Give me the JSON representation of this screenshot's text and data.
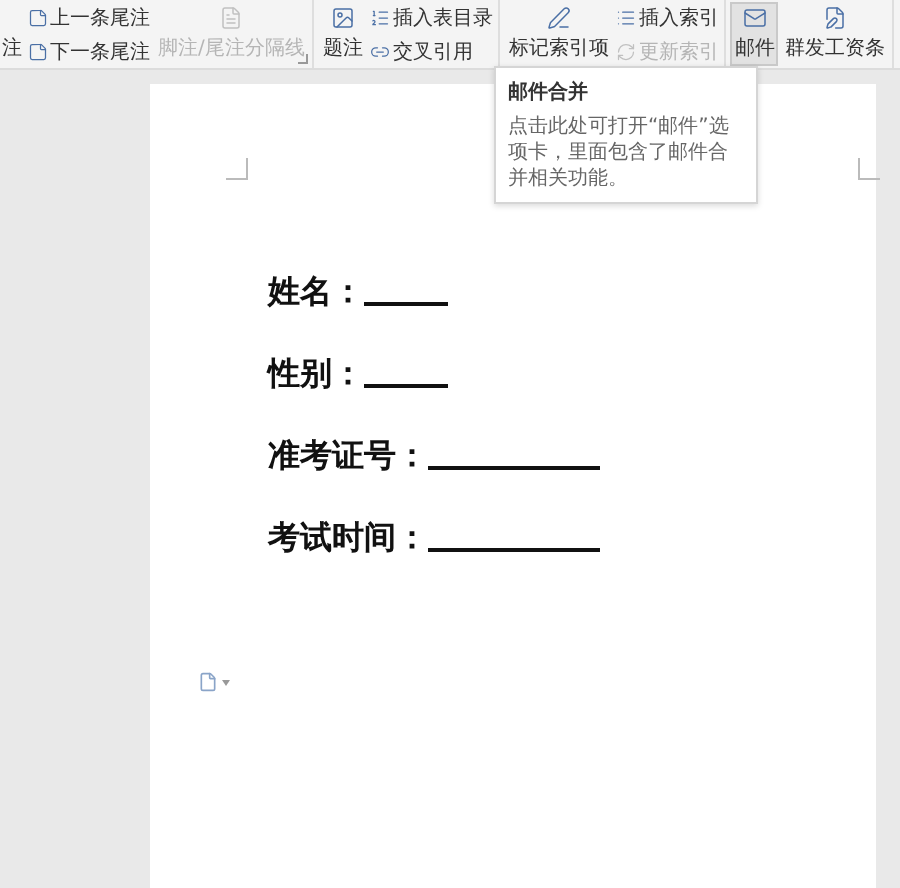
{
  "toolbar": {
    "leading_label": "注",
    "groups": [
      {
        "items": [
          {
            "kind": "stack",
            "rows": [
              {
                "label": "上一条尾注",
                "disabled": false
              },
              {
                "label": "下一条尾注",
                "disabled": false
              }
            ]
          },
          {
            "kind": "large",
            "label": "脚注/尾注分隔线",
            "disabled": true,
            "selected": false
          }
        ],
        "launcher": true
      },
      {
        "items": [
          {
            "kind": "large",
            "label": "题注",
            "disabled": false,
            "selected": false
          },
          {
            "kind": "stack",
            "rows": [
              {
                "label": "插入表目录",
                "disabled": false
              },
              {
                "label": "交叉引用",
                "disabled": false
              }
            ]
          }
        ],
        "launcher": false
      },
      {
        "items": [
          {
            "kind": "large",
            "label": "标记索引项",
            "disabled": false,
            "selected": false
          },
          {
            "kind": "stack",
            "rows": [
              {
                "label": "插入索引",
                "disabled": false
              },
              {
                "label": "更新索引",
                "disabled": true
              }
            ]
          }
        ],
        "launcher": false
      },
      {
        "items": [
          {
            "kind": "large",
            "label": "邮件",
            "disabled": false,
            "selected": true
          },
          {
            "kind": "large",
            "label": "群发工资条",
            "disabled": false,
            "selected": false
          }
        ],
        "launcher": false
      }
    ]
  },
  "tooltip": {
    "title": "邮件合并",
    "body": "点击此处可打开“邮件”选项卡，里面包含了邮件合并相关功能。"
  },
  "document": {
    "fields": [
      {
        "label": "姓名：",
        "kind": "short"
      },
      {
        "label": "性别：",
        "kind": "short"
      },
      {
        "label": "准考证号：",
        "kind": "long"
      },
      {
        "label": "考试时间：",
        "kind": "long"
      }
    ]
  }
}
